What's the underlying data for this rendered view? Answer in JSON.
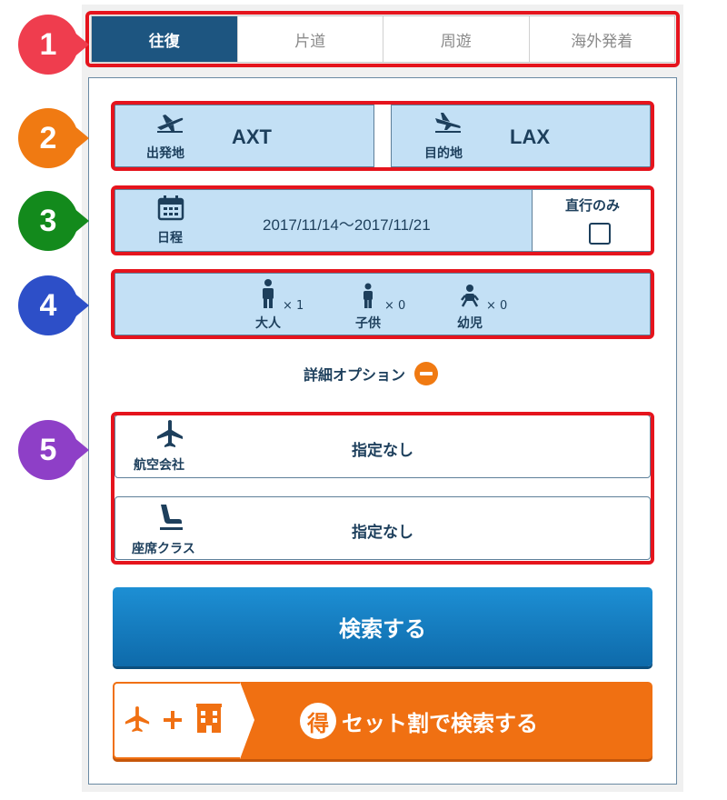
{
  "tabs": [
    {
      "label": "往復",
      "active": true
    },
    {
      "label": "片道",
      "active": false
    },
    {
      "label": "周遊",
      "active": false
    },
    {
      "label": "海外発着",
      "active": false
    }
  ],
  "markers": [
    {
      "number": "1",
      "color": "#ef3d4e"
    },
    {
      "number": "2",
      "color": "#f07a12"
    },
    {
      "number": "3",
      "color": "#138a1c"
    },
    {
      "number": "4",
      "color": "#2d4fc8"
    },
    {
      "number": "5",
      "color": "#8e3fc7"
    }
  ],
  "route": {
    "origin_label": "出発地",
    "origin_code": "AXT",
    "destination_label": "目的地",
    "destination_code": "LAX"
  },
  "schedule": {
    "label": "日程",
    "dates": "2017/11/14〜2017/11/21",
    "direct_only_label": "直行のみ",
    "direct_only_checked": false
  },
  "passengers": [
    {
      "label": "大人",
      "count": "× 1",
      "icon": "adult-icon"
    },
    {
      "label": "子供",
      "count": "× 0",
      "icon": "child-icon"
    },
    {
      "label": "幼児",
      "count": "× 0",
      "icon": "infant-icon"
    }
  ],
  "options_toggle": {
    "label": "詳細オプション",
    "icon": "minus-circle-icon"
  },
  "airline": {
    "label": "航空会社",
    "value": "指定なし",
    "icon": "airplane-icon"
  },
  "seat_class": {
    "label": "座席クラス",
    "value": "指定なし",
    "icon": "seat-icon"
  },
  "search_button": {
    "label": "検索する"
  },
  "set_discount": {
    "badge": "得",
    "label": "セット割で検索する"
  },
  "colors": {
    "accent_navy": "#1d5580",
    "field_blue": "#c3e0f5",
    "search_blue": "#1479bd",
    "set_orange": "#f07012",
    "highlight_red": "#e5141d"
  }
}
